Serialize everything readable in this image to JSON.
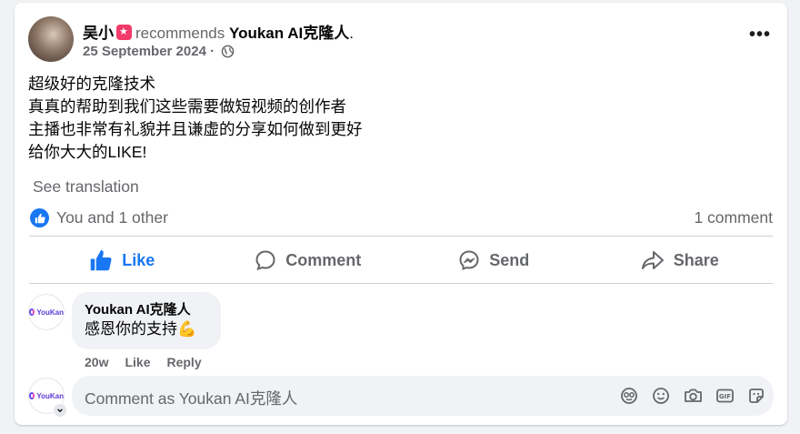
{
  "post": {
    "author": "吴小",
    "verb": "recommends",
    "page": "Youkan AI克隆人",
    "page_suffix": ".",
    "date": "25 September 2024",
    "date_sep": "·",
    "text_lines": [
      "超级好的克隆技术",
      "真真的帮助到我们这些需要做短视频的创作者",
      "主播也非常有礼貌并且谦虚的分享如何做到更好",
      "给你大大的LIKE!"
    ],
    "see_translation": "See translation",
    "reactions_text": "You and 1 other",
    "comment_count": "1 comment"
  },
  "actions": {
    "like": "Like",
    "comment": "Comment",
    "send": "Send",
    "share": "Share"
  },
  "comment": {
    "avatar_text": "YouKan",
    "author": "Youkan AI克隆人",
    "text": "感恩你的支持💪",
    "time": "20w",
    "like": "Like",
    "reply": "Reply"
  },
  "composer": {
    "avatar_text": "YouKan",
    "placeholder": "Comment as Youkan AI克隆人"
  },
  "icons": {
    "more": "more-options-icon",
    "audience": "globe-icon",
    "like": "thumbs-up-icon",
    "comment": "speech-bubble-icon",
    "send": "messenger-icon",
    "share": "share-arrow-icon",
    "avatar_sticker": "avatar-sticker-icon",
    "emoji": "emoji-icon",
    "camera": "camera-icon",
    "gif": "gif-icon",
    "sticker": "sticker-icon"
  },
  "colors": {
    "accent": "#1877f2",
    "muted": "#65676b",
    "badge": "#f23b6b"
  }
}
